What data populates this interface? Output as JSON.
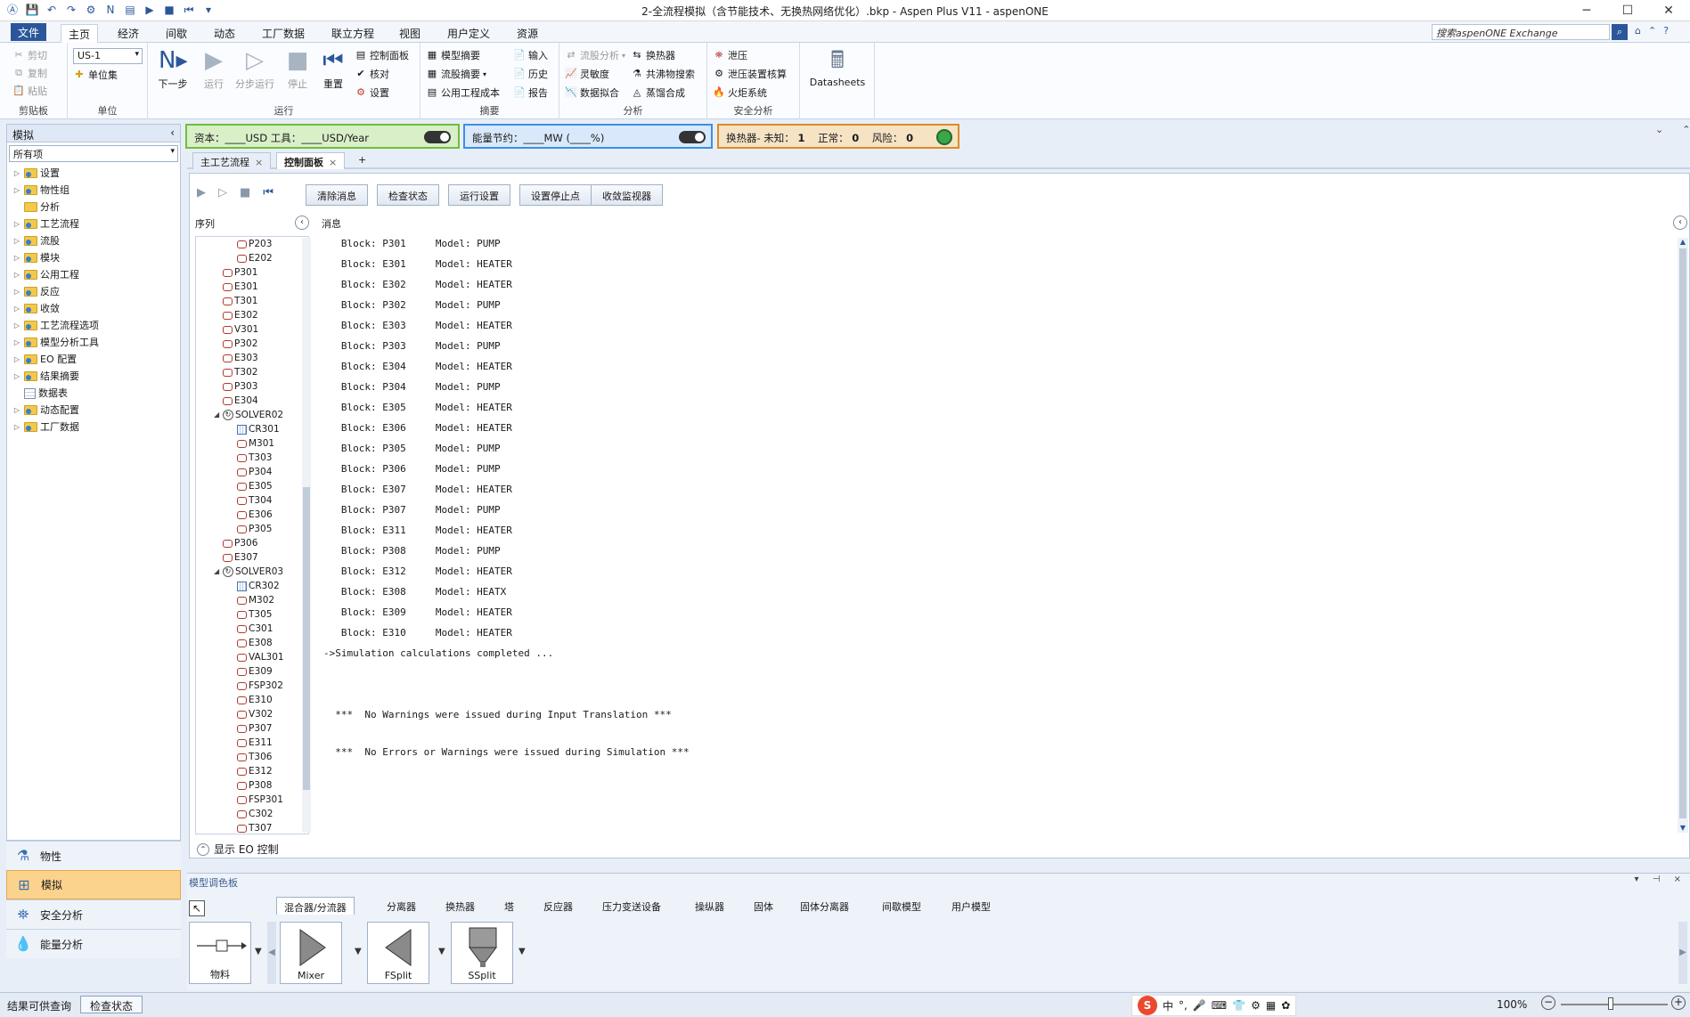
{
  "window": {
    "title": "2-全流程模拟（含节能技术、无换热网络优化）.bkp - Aspen Plus V11 - aspenONE",
    "minimize": "─",
    "maximize": "☐",
    "close": "✕"
  },
  "menu": {
    "tabs": [
      "文件",
      "主页",
      "经济",
      "间歇",
      "动态",
      "工厂数据",
      "联立方程",
      "视图",
      "用户定义",
      "资源"
    ],
    "search_placeholder": "搜索aspenONE Exchange"
  },
  "ribbon": {
    "clipboard": {
      "cut": "剪切",
      "copy": "复制",
      "paste": "粘贴",
      "label": "剪贴板"
    },
    "units": {
      "selected": "US-1",
      "unit_set": "单位集",
      "label": "单位"
    },
    "run": {
      "next": "下一步",
      "run": "运行",
      "step": "分步运行",
      "stop": "停止",
      "reset": "重置",
      "control_panel": "控制面板",
      "check": "核对",
      "settings": "设置",
      "label": "运行"
    },
    "summary": {
      "model_summary": "模型摘要",
      "stream_summary": "流股摘要",
      "utility_costs": "公用工程成本",
      "input": "输入",
      "history": "历史",
      "report": "报告",
      "label": "摘要"
    },
    "analysis": {
      "stream_analysis": "流股分析",
      "heat_exchanger": "换热器",
      "sensitivity": "灵敏度",
      "azeotrope_search": "共沸物搜索",
      "data_fit": "数据拟合",
      "distillation_synthesis": "蒸馏合成",
      "label": "分析"
    },
    "safety": {
      "pressure_relief": "泄压",
      "relief_rating": "泄压装置核算",
      "flare_system": "火炬系统",
      "label": "安全分析"
    },
    "datasheets": "Datasheets"
  },
  "indicators": {
    "capital": "资本：____USD   工具：____USD/Year",
    "energy": "能量节约：____MW   (____%)",
    "hx": {
      "label": "换热器- 未知：",
      "unknown": "1",
      "normal_label": "正常：",
      "normal": "0",
      "risk_label": "风险：",
      "risk": "0"
    }
  },
  "nav": {
    "header": "模拟",
    "filter": "所有项",
    "items": [
      "设置",
      "物性组",
      "分析",
      "工艺流程",
      "流股",
      "模块",
      "公用工程",
      "反应",
      "收敛",
      "工艺流程选项",
      "模型分析工具",
      "EO 配置",
      "结果摘要",
      "数据表",
      "动态配置",
      "工厂数据"
    ],
    "sections": [
      "物性",
      "模拟",
      "安全分析",
      "能量分析"
    ]
  },
  "doctabs": [
    "主工艺流程",
    "控制面板",
    "+"
  ],
  "control_panel": {
    "buttons": [
      "清除消息",
      "检查状态",
      "运行设置",
      "设置停止点",
      "收敛监视器"
    ],
    "seq_header": "序列",
    "msg_header": "消息",
    "show_eo": "显示 EO 控制",
    "sequence": [
      {
        "name": "P203",
        "kind": "block",
        "indent": 2
      },
      {
        "name": "E202",
        "kind": "block",
        "indent": 2
      },
      {
        "name": "P301",
        "kind": "block",
        "indent": 1
      },
      {
        "name": "E301",
        "kind": "block",
        "indent": 1
      },
      {
        "name": "T301",
        "kind": "block",
        "indent": 1
      },
      {
        "name": "E302",
        "kind": "block",
        "indent": 1
      },
      {
        "name": "V301",
        "kind": "block",
        "indent": 1
      },
      {
        "name": "P302",
        "kind": "block",
        "indent": 1
      },
      {
        "name": "E303",
        "kind": "block",
        "indent": 1
      },
      {
        "name": "T302",
        "kind": "block",
        "indent": 1
      },
      {
        "name": "P303",
        "kind": "block",
        "indent": 1
      },
      {
        "name": "E304",
        "kind": "block",
        "indent": 1
      },
      {
        "name": "SOLVER02",
        "kind": "solver",
        "indent": 1
      },
      {
        "name": "CR301",
        "kind": "conv",
        "indent": 2
      },
      {
        "name": "M301",
        "kind": "block",
        "indent": 2
      },
      {
        "name": "T303",
        "kind": "block",
        "indent": 2
      },
      {
        "name": "P304",
        "kind": "block",
        "indent": 2
      },
      {
        "name": "E305",
        "kind": "block",
        "indent": 2
      },
      {
        "name": "T304",
        "kind": "block",
        "indent": 2
      },
      {
        "name": "E306",
        "kind": "block",
        "indent": 2
      },
      {
        "name": "P305",
        "kind": "block",
        "indent": 2
      },
      {
        "name": "P306",
        "kind": "block",
        "indent": 1
      },
      {
        "name": "E307",
        "kind": "block",
        "indent": 1
      },
      {
        "name": "SOLVER03",
        "kind": "solver",
        "indent": 1
      },
      {
        "name": "CR302",
        "kind": "conv",
        "indent": 2
      },
      {
        "name": "M302",
        "kind": "block",
        "indent": 2
      },
      {
        "name": "T305",
        "kind": "block",
        "indent": 2
      },
      {
        "name": "C301",
        "kind": "block",
        "indent": 2
      },
      {
        "name": "E308",
        "kind": "block",
        "indent": 2
      },
      {
        "name": "VAL301",
        "kind": "block",
        "indent": 2
      },
      {
        "name": "E309",
        "kind": "block",
        "indent": 2
      },
      {
        "name": "FSP302",
        "kind": "block",
        "indent": 2
      },
      {
        "name": "E310",
        "kind": "block",
        "indent": 2
      },
      {
        "name": "V302",
        "kind": "block",
        "indent": 2
      },
      {
        "name": "P307",
        "kind": "block",
        "indent": 2
      },
      {
        "name": "E311",
        "kind": "block",
        "indent": 2
      },
      {
        "name": "T306",
        "kind": "block",
        "indent": 2
      },
      {
        "name": "E312",
        "kind": "block",
        "indent": 2
      },
      {
        "name": "P308",
        "kind": "block",
        "indent": 2
      },
      {
        "name": "FSP301",
        "kind": "block",
        "indent": 2
      },
      {
        "name": "C302",
        "kind": "block",
        "indent": 2
      },
      {
        "name": "T307",
        "kind": "block",
        "indent": 2
      }
    ],
    "messages": [
      "   Block: P301     Model: PUMP",
      "   Block: E301     Model: HEATER",
      "   Block: E302     Model: HEATER",
      "   Block: P302     Model: PUMP",
      "   Block: E303     Model: HEATER",
      "   Block: P303     Model: PUMP",
      "   Block: E304     Model: HEATER",
      "   Block: P304     Model: PUMP",
      "   Block: E305     Model: HEATER",
      "   Block: E306     Model: HEATER",
      "   Block: P305     Model: PUMP",
      "   Block: P306     Model: PUMP",
      "   Block: E307     Model: HEATER",
      "   Block: P307     Model: PUMP",
      "   Block: E311     Model: HEATER",
      "   Block: P308     Model: PUMP",
      "   Block: E312     Model: HEATER",
      "   Block: E308     Model: HEATX",
      "   Block: E309     Model: HEATER",
      "   Block: E310     Model: HEATER",
      "->Simulation calculations completed ...",
      "",
      "",
      "  ***  No Warnings were issued during Input Translation ***",
      "",
      "  ***  No Errors or Warnings were issued during Simulation ***"
    ]
  },
  "palette": {
    "title": "模型调色板",
    "tabs": [
      "混合器/分流器",
      "分离器",
      "换热器",
      "塔",
      "反应器",
      "压力变送设备",
      "操纵器",
      "固体",
      "固体分离器",
      "间歇模型",
      "用户模型"
    ],
    "items": [
      "物料",
      "Mixer",
      "FSplit",
      "SSplit"
    ]
  },
  "status": {
    "left": "结果可供查询",
    "check_btn": "检查状态",
    "zoom": "100%",
    "ime": [
      "中",
      "°,",
      "🎤",
      "⌨",
      "👕",
      "⚙",
      "▦",
      "✿"
    ]
  }
}
